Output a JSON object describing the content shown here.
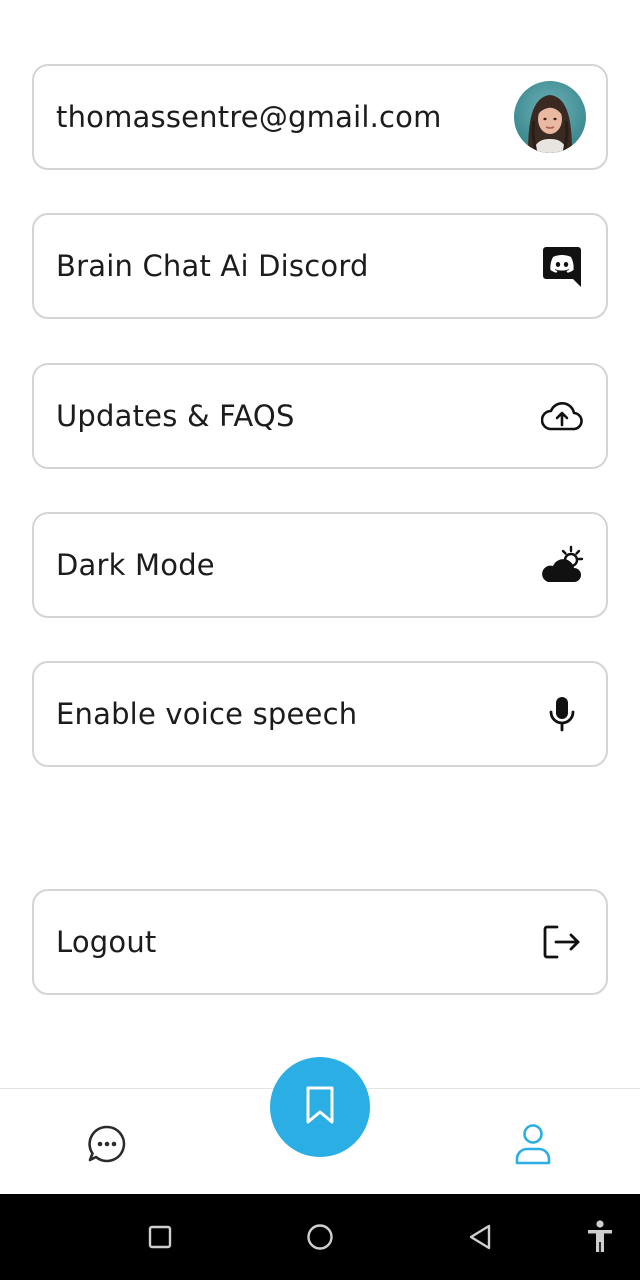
{
  "settings": {
    "items": [
      {
        "label": "thomassentre@gmail.com",
        "icon": "avatar"
      },
      {
        "label": "Brain Chat Ai Discord",
        "icon": "discord-icon"
      },
      {
        "label": "Updates & FAQS",
        "icon": "cloud-upload-icon"
      },
      {
        "label": "Dark Mode",
        "icon": "cloud-sun-icon"
      },
      {
        "label": "Enable voice speech",
        "icon": "microphone-icon"
      }
    ],
    "logout": {
      "label": "Logout",
      "icon": "logout-icon"
    }
  },
  "bottom_nav": {
    "items": [
      {
        "icon": "chat-bubble-icon"
      },
      {
        "icon": "bookmark-icon"
      },
      {
        "icon": "profile-icon"
      }
    ],
    "accent_color": "#2aaee3"
  },
  "system_nav": {
    "buttons": [
      "recents-icon",
      "home-icon",
      "back-icon",
      "accessibility-icon"
    ]
  }
}
